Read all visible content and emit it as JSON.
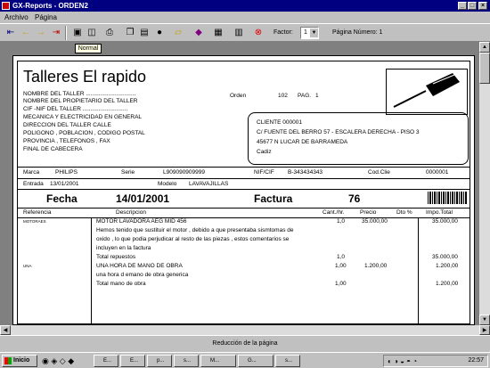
{
  "window": {
    "title": "GX-Reports - ORDEN2",
    "buttons": {
      "minimize": "_",
      "maximize": "□",
      "close": "×"
    }
  },
  "menu": [
    "Archivo",
    "Página"
  ],
  "toolbar": {
    "factor_label": "Factor:",
    "factor_value": "1",
    "page_label": "Página Número: 1",
    "tooltip": "Normal"
  },
  "report": {
    "company": "Talleres El rapido",
    "left_lines": [
      "NOMBRE DEL TALLER ...............................",
      "NOMBRE DEL PROPIETARIO DEL TALLER",
      "CIF -NIF DEL TALLER ............................",
      "MECANICA Y ELECTRICIDAD EN GENERAL",
      "DIRECCION DEL TALLER CALLE",
      "POLIGONO , POBLACION , CODIGO POSTAL",
      "PROVINCIA , TELEFONOS , FAX",
      "FINAL DE CABECERA"
    ],
    "orden_label": "Orden",
    "orden_value": "102",
    "pag_label": "PAG.",
    "pag_value": "1",
    "client": [
      "CLIENTE 000001",
      "C/ FUENTE DEL BERRO 57 - ESCALERA DERECHA - PISO 3",
      "45677  N LUCAR DE BARRAMEDA",
      "Cadiz"
    ],
    "marca_label": "Marca",
    "marca_value": "PHILIPS",
    "serie_label": "Serie",
    "serie_value": "L909090909999",
    "nif_label": "NIF/CIF",
    "nif_value": "B-343434343",
    "cod_label": "Cod.Clie",
    "cod_value": "0000001",
    "entrada_label": "Entrada",
    "entrada_value": "13/01/2001",
    "modelo_label": "Modelo",
    "modelo_value": "LAVAVAJILLAS",
    "fecha_label": "Fecha",
    "fecha_value": "14/01/2001",
    "factura_label": "Factura",
    "factura_value": "76",
    "columns": {
      "ref": "Referencia",
      "desc": "Descripcion",
      "cant": "Cant./hr.",
      "precio": "Precio",
      "dto": "Dto %",
      "impo": "Impo.Total"
    },
    "rows": [
      {
        "ref": "MOTORAES",
        "desc": "MOTOR LAVADORA AEG MID 456",
        "cant": "1,0",
        "precio": "35.000,00",
        "dto": "",
        "impo": "35.000,00"
      },
      {
        "ref": "",
        "desc": "Hemos tenido que sustituir el motor , debido a que presentaba sismtomas de",
        "cant": "",
        "precio": "",
        "dto": "",
        "impo": ""
      },
      {
        "ref": "",
        "desc": "oxido , lo que podia perjudicar al resto de las piezas , estos comentarios se",
        "cant": "",
        "precio": "",
        "dto": "",
        "impo": ""
      },
      {
        "ref": "",
        "desc": "incluyen en la factura",
        "cant": "",
        "precio": "",
        "dto": "",
        "impo": ""
      },
      {
        "ref": "",
        "desc": "Total repuestos",
        "cant": "1,0",
        "precio": "",
        "dto": "",
        "impo": "35.000,00"
      },
      {
        "ref": "UNA",
        "desc": "UNA HORA DE MANO DE OBRA",
        "cant": "1,00",
        "precio": "1.200,00",
        "dto": "",
        "impo": "1.200,00"
      },
      {
        "ref": "",
        "desc": "una hora d emano de obra generica",
        "cant": "",
        "precio": "",
        "dto": "",
        "impo": ""
      },
      {
        "ref": "",
        "desc": "Total mano de obra",
        "cant": "1,00",
        "precio": "",
        "dto": "",
        "impo": "1.200,00"
      }
    ]
  },
  "status": "Reducción de la página",
  "taskbar": {
    "start": "Inicio",
    "tasks": [
      "E...",
      "E...",
      "p...",
      "s...",
      "M...",
      "G...",
      "s..."
    ],
    "clock": "22:57"
  }
}
